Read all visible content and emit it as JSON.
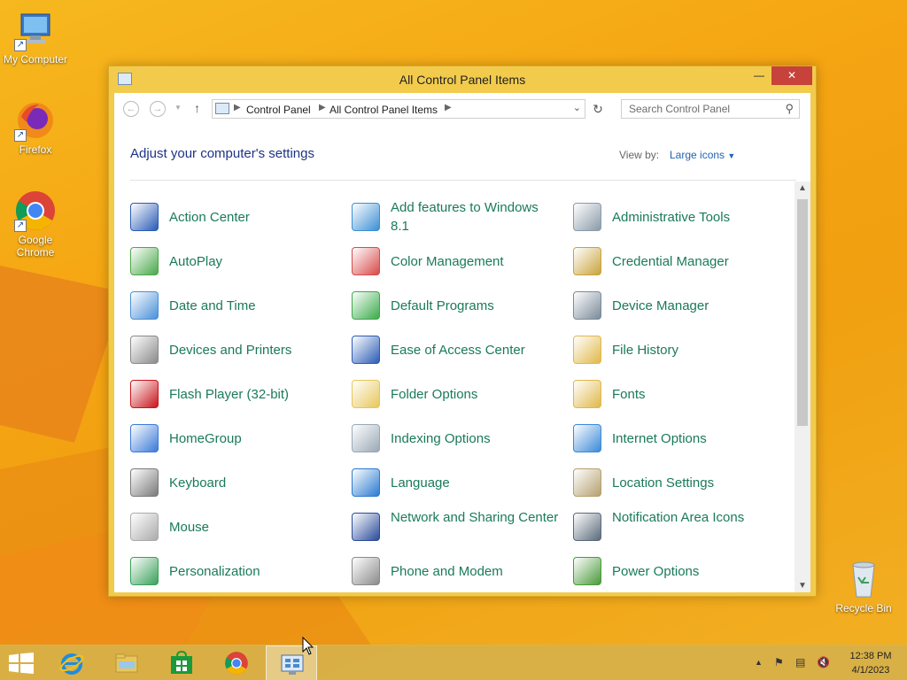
{
  "desktop": {
    "icons": [
      {
        "label": "My Computer",
        "icon": "computer-icon"
      },
      {
        "label": "Firefox",
        "icon": "firefox-icon"
      },
      {
        "label": "Google Chrome",
        "icon": "chrome-icon"
      },
      {
        "label": "Recycle Bin",
        "icon": "recycle-bin-icon"
      }
    ]
  },
  "window": {
    "title": "All Control Panel Items",
    "controls": {
      "minimize": "—",
      "maximize": "☐",
      "close": "✕"
    },
    "address": {
      "crumbs": [
        "Control Panel",
        "All Control Panel Items"
      ]
    },
    "search_placeholder": "Search Control Panel",
    "heading": "Adjust your computer's settings",
    "view_by_label": "View by:",
    "view_by_value": "Large icons",
    "items": [
      {
        "label": "Action Center",
        "icon": "flag-icon",
        "color": "#2a5bb5"
      },
      {
        "label": "Add features to Windows 8.1",
        "icon": "add-features-icon",
        "color": "#3b8fd4"
      },
      {
        "label": "Administrative Tools",
        "icon": "admin-tools-icon",
        "color": "#8a9aa8"
      },
      {
        "label": "AutoPlay",
        "icon": "autoplay-icon",
        "color": "#4aa84a"
      },
      {
        "label": "Color Management",
        "icon": "color-management-icon",
        "color": "#d84a4a"
      },
      {
        "label": "Credential Manager",
        "icon": "credential-icon",
        "color": "#c9a33c"
      },
      {
        "label": "Date and Time",
        "icon": "clock-icon",
        "color": "#4a90d8"
      },
      {
        "label": "Default Programs",
        "icon": "default-programs-icon",
        "color": "#3aaa4a"
      },
      {
        "label": "Device Manager",
        "icon": "device-manager-icon",
        "color": "#7a8a99"
      },
      {
        "label": "Devices and Printers",
        "icon": "printer-icon",
        "color": "#8a8a8a"
      },
      {
        "label": "Ease of Access Center",
        "icon": "ease-of-access-icon",
        "color": "#2a5bb5"
      },
      {
        "label": "File History",
        "icon": "file-history-icon",
        "color": "#e0b84a"
      },
      {
        "label": "Flash Player (32-bit)",
        "icon": "flash-icon",
        "color": "#c8141a"
      },
      {
        "label": "Folder Options",
        "icon": "folder-options-icon",
        "color": "#e8c65a"
      },
      {
        "label": "Fonts",
        "icon": "fonts-icon",
        "color": "#e0b84a"
      },
      {
        "label": "HomeGroup",
        "icon": "homegroup-icon",
        "color": "#3a7ad8"
      },
      {
        "label": "Indexing Options",
        "icon": "indexing-icon",
        "color": "#9aa8b5"
      },
      {
        "label": "Internet Options",
        "icon": "internet-options-icon",
        "color": "#3a8ad8"
      },
      {
        "label": "Keyboard",
        "icon": "keyboard-icon",
        "color": "#7a7a7a"
      },
      {
        "label": "Language",
        "icon": "language-icon",
        "color": "#2a7ad0"
      },
      {
        "label": "Location Settings",
        "icon": "location-icon",
        "color": "#b5a070"
      },
      {
        "label": "Mouse",
        "icon": "mouse-icon",
        "color": "#aaaaaa"
      },
      {
        "label": "Network and Sharing Center",
        "icon": "network-icon",
        "color": "#2a4a9a"
      },
      {
        "label": "Notification Area Icons",
        "icon": "notification-icon",
        "color": "#5a6a7a"
      },
      {
        "label": "Personalization",
        "icon": "personalization-icon",
        "color": "#3aa05a"
      },
      {
        "label": "Phone and Modem",
        "icon": "phone-icon",
        "color": "#8a8a8a"
      },
      {
        "label": "Power Options",
        "icon": "power-icon",
        "color": "#4a9a3a"
      }
    ]
  },
  "taskbar": {
    "apps": [
      {
        "name": "start",
        "icon": "windows-start-icon"
      },
      {
        "name": "ie",
        "icon": "internet-explorer-icon"
      },
      {
        "name": "explorer",
        "icon": "file-explorer-icon"
      },
      {
        "name": "store",
        "icon": "store-icon"
      },
      {
        "name": "chrome",
        "icon": "chrome-icon"
      },
      {
        "name": "control-panel",
        "icon": "control-panel-icon"
      }
    ],
    "time": "12:38 PM",
    "date": "4/1/2023"
  }
}
